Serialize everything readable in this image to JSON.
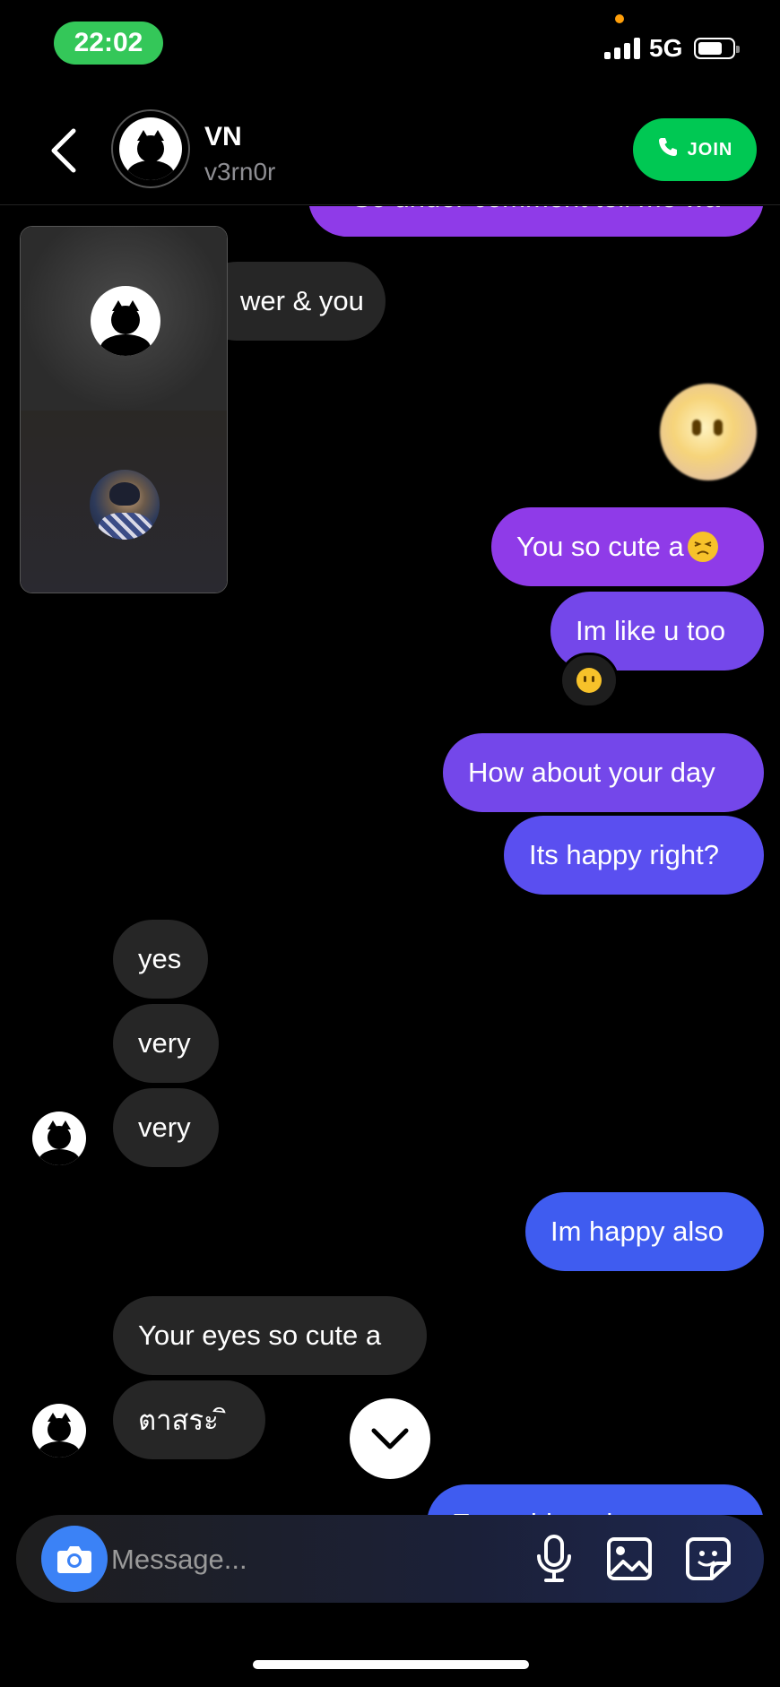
{
  "status_bar": {
    "time": "22:02",
    "network": "5G"
  },
  "header": {
    "name": "VN",
    "username": "v3rn0r",
    "join_label": "JOIN"
  },
  "messages": {
    "partial_top": "So under comment tell me wa",
    "m1": "wer & you",
    "m2": "You so cute a",
    "m3": "Im like u too",
    "m4": "How about your day",
    "m5": "Its happy right?",
    "m6": "yes",
    "m7": "very",
    "m8": "very",
    "m9": "Im happy also",
    "m10": "Your eyes so cute a",
    "m11": "ตาสระ ิ",
    "partial_bottom": "Everything about you"
  },
  "composer": {
    "placeholder": "Message..."
  }
}
